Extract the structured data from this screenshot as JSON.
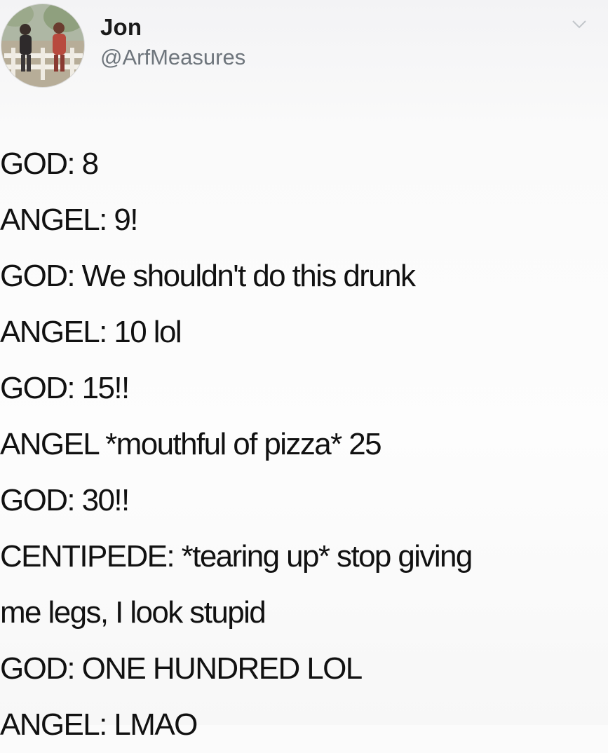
{
  "author": {
    "display_name": "Jon",
    "handle": "@ArfMeasures"
  },
  "icons": {
    "avatar": "profile-photo",
    "caret": "chevron-down-icon"
  },
  "colors": {
    "text": "#111111",
    "handle": "#6e757c",
    "background": "#fbfbfb"
  },
  "tweet": {
    "lines": [
      "GOD: 8",
      "ANGEL: 9!",
      "GOD: We shouldn't do this drunk",
      "ANGEL: 10 lol",
      "GOD: 15!!",
      "ANGEL *mouthful of pizza* 25",
      "GOD: 30!!",
      "CENTIPEDE: *tearing up* stop giving",
      "me legs, I look stupid",
      "GOD: ONE HUNDRED LOL",
      "ANGEL: LMAO"
    ]
  }
}
